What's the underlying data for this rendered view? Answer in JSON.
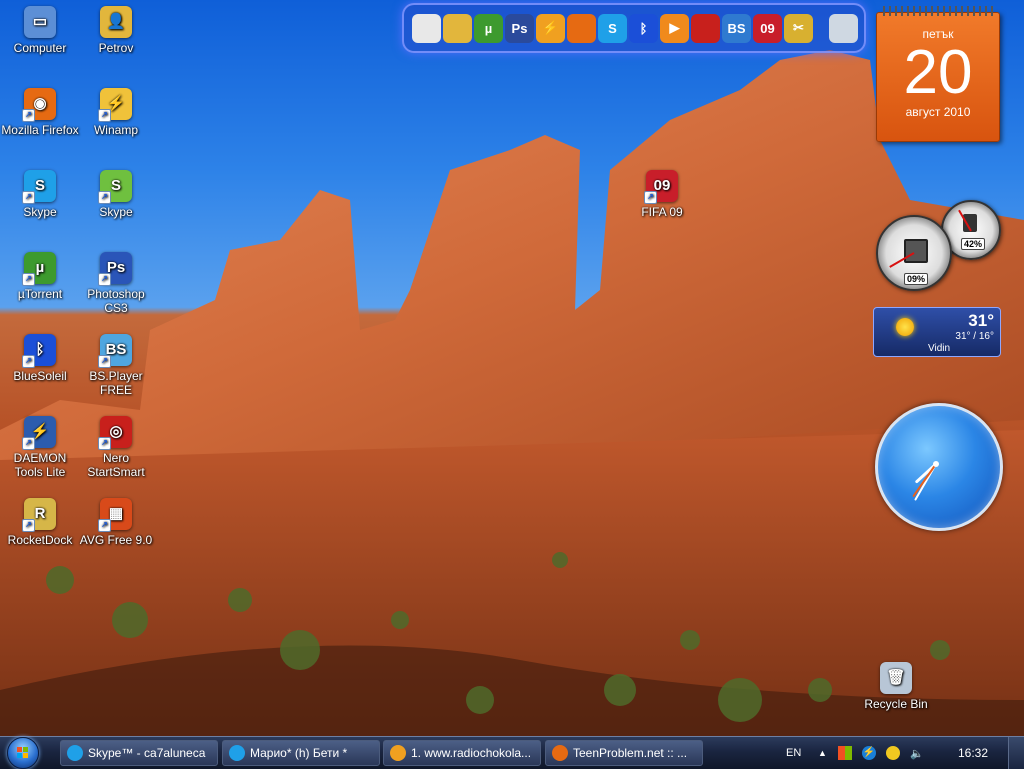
{
  "desktop_icons": [
    {
      "label": "Computer",
      "icon": "computer-icon",
      "color": "#5c8fd6"
    },
    {
      "label": "Petrov",
      "icon": "user-folder-icon",
      "color": "#e2b63c"
    },
    {
      "label": "Mozilla Firefox",
      "icon": "firefox-icon",
      "color": "#e66a12"
    },
    {
      "label": "Winamp",
      "icon": "winamp-icon",
      "color": "#f0c23a"
    },
    {
      "label": "Skype",
      "icon": "skype-icon",
      "color": "#1fa0e8"
    },
    {
      "label": "Skype",
      "icon": "skype-icon",
      "color": "#6fc03f"
    },
    {
      "label": "µTorrent",
      "icon": "utorrent-icon",
      "color": "#3d9a2e"
    },
    {
      "label": "Photoshop CS3",
      "icon": "photoshop-icon",
      "color": "#2a55b8"
    },
    {
      "label": "BlueSoleil",
      "icon": "bluetooth-icon",
      "color": "#1b4fd8"
    },
    {
      "label": "BS.Player FREE",
      "icon": "bsplayer-icon",
      "color": "#4fa6e0"
    },
    {
      "label": "DAEMON Tools Lite",
      "icon": "daemon-tools-icon",
      "color": "#2c5cae"
    },
    {
      "label": "Nero StartSmart",
      "icon": "nero-icon",
      "color": "#c8201c"
    },
    {
      "label": "RocketDock",
      "icon": "rocketdock-icon",
      "color": "#d6b648"
    },
    {
      "label": "AVG Free 9.0",
      "icon": "avg-icon",
      "color": "#d84a1a"
    },
    {
      "label": "FIFA 09",
      "icon": "fifa-icon",
      "color": "#c81e2a"
    },
    {
      "label": "Recycle Bin",
      "icon": "recycle-bin-icon",
      "color": "#b8c6d6"
    }
  ],
  "dock_items": [
    {
      "icon": "notepad-icon",
      "glyph": "",
      "color": "#e8e8e8"
    },
    {
      "icon": "user-folder-icon",
      "glyph": "",
      "color": "#e2b63c"
    },
    {
      "icon": "utorrent-icon",
      "glyph": "µ",
      "color": "#3d9a2e"
    },
    {
      "icon": "photoshop-icon",
      "glyph": "Ps",
      "color": "#2a4a9c"
    },
    {
      "icon": "winamp-icon",
      "glyph": "⚡",
      "color": "#f0a020"
    },
    {
      "icon": "firefox-icon",
      "glyph": "",
      "color": "#e66a12"
    },
    {
      "icon": "skype-icon",
      "glyph": "S",
      "color": "#1fa0e8"
    },
    {
      "icon": "bluetooth-icon",
      "glyph": "ᛒ",
      "color": "#1b4fd8"
    },
    {
      "icon": "media-player-icon",
      "glyph": "▶",
      "color": "#f08a1c"
    },
    {
      "icon": "nero-icon",
      "glyph": "",
      "color": "#c8201c"
    },
    {
      "icon": "bsplayer-icon",
      "glyph": "BS",
      "color": "#2f7ad0"
    },
    {
      "icon": "fifa-icon",
      "glyph": "09",
      "color": "#c81e2a"
    },
    {
      "icon": "tools-icon",
      "glyph": "✂",
      "color": "#d8b030"
    },
    {
      "icon": "recycle-bin-icon",
      "glyph": "",
      "color": "#cfd8e2"
    }
  ],
  "calendar": {
    "day_of_week": "петък",
    "day": "20",
    "month_year": "август 2010"
  },
  "meters": {
    "cpu_percent": "09%",
    "memory_percent": "42%"
  },
  "weather": {
    "temperature": "31°",
    "range": "31° / 16°",
    "city": "Vidin"
  },
  "clock": {
    "hour": 7,
    "minute": 35
  },
  "taskbar": {
    "tasks": [
      {
        "label": "Skype™ - ca7aluneca",
        "icon": "skype-icon",
        "color": "#1fa0e8"
      },
      {
        "label": "Марио* (h) Бети *",
        "icon": "skype-icon",
        "color": "#1fa0e8"
      },
      {
        "label": "1. www.radiochokola...",
        "icon": "winamp-icon",
        "color": "#f0a020"
      },
      {
        "label": "TeenProblem.net :: ...",
        "icon": "firefox-icon",
        "color": "#e66a12"
      }
    ],
    "language": "EN",
    "time": "16:32",
    "tray_icons": [
      "show-hidden-icons-icon",
      "windows-flag-icon",
      "winamp-tray-icon",
      "skype-tray-icon",
      "network-icon",
      "volume-icon"
    ]
  }
}
